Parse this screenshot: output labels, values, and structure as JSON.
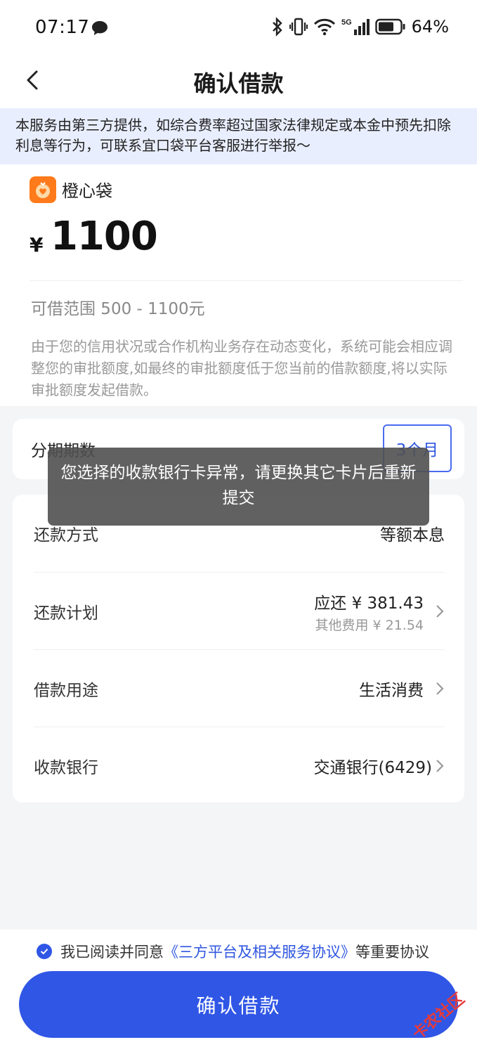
{
  "status_bar": {
    "time": "07:17",
    "battery": "64%",
    "network": "5G"
  },
  "nav": {
    "title": "确认借款"
  },
  "notice": "本服务由第三方提供，如综合费率超过国家法律规定或本金中预先扣除利息等行为，可联系宜口袋平台客服进行举报～",
  "loan": {
    "lender": "橙心袋",
    "currency": "¥",
    "amount": "1100",
    "range": "可借范围 500 - 1100元",
    "description": "由于您的信用状况或合作机构业务存在动态变化，系统可能会相应调整您的审批额度,如最终的审批额度低于您当前的借款额度,将以实际审批额度发起借款。"
  },
  "term": {
    "label": "分期期数",
    "selected": "3个月"
  },
  "details": {
    "repay_method_label": "还款方式",
    "repay_method_value": "等额本息",
    "plan_label": "还款计划",
    "plan_main": "应还 ¥ 381.43",
    "plan_sub": "其他费用 ¥ 21.54",
    "purpose_label": "借款用途",
    "purpose_value": "生活消费",
    "bank_label": "收款银行",
    "bank_value": "交通银行(6429)"
  },
  "toast": "您选择的收款银行卡异常，请更换其它卡片后重新提交",
  "agreement": {
    "prefix": "我已阅读并同意",
    "link": "《三方平台及相关服务协议》",
    "suffix": "等重要协议"
  },
  "confirm_button": "确认借款",
  "watermark": "卡农社区",
  "colors": {
    "primary": "#3056e6",
    "notice_bg": "#e9eefe",
    "lender_logo": "#ff7a1a"
  }
}
